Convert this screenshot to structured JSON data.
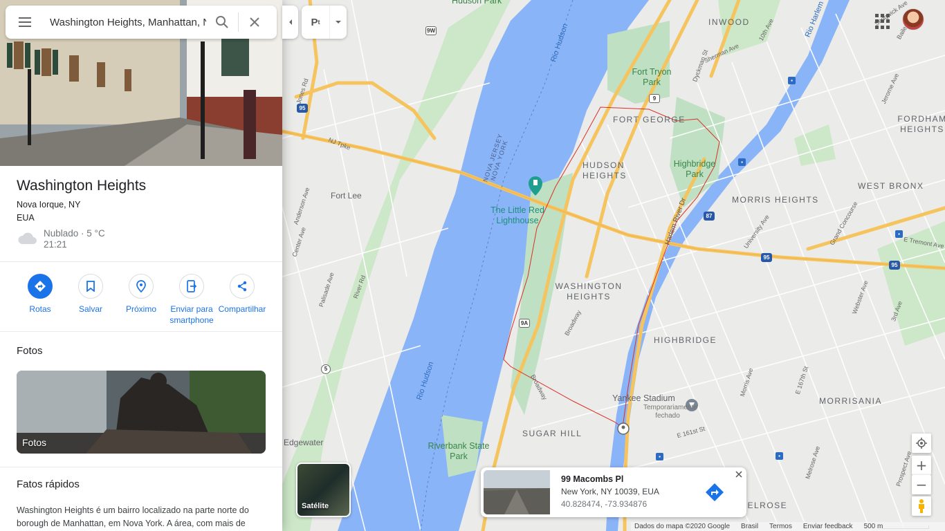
{
  "search": {
    "value": "Washington Heights, Manhattan, N",
    "menu": "menu-icon",
    "search_icon": "search-icon",
    "close_icon": "close-icon"
  },
  "place": {
    "title": "Washington Heights",
    "region": "Nova Iorque, NY",
    "country": "EUA",
    "weather": "Nublado · 5 °C",
    "time": "21:21"
  },
  "actions": [
    {
      "label": "Rotas",
      "icon": "directions-icon"
    },
    {
      "label": "Salvar",
      "icon": "bookmark-icon"
    },
    {
      "label": "Próximo",
      "icon": "nearby-icon"
    },
    {
      "label": "Enviar para smartphone",
      "icon": "send-to-phone-icon"
    },
    {
      "label": "Compartilhar",
      "icon": "share-icon"
    }
  ],
  "photos": {
    "section_title": "Fotos",
    "label": "Fotos"
  },
  "facts": {
    "section_title": "Fatos rápidos",
    "text": "Washington Heights é um bairro localizado na parte norte do borough de Manhattan, em Nova York. A área, com mais de"
  },
  "map": {
    "neighborhoods": [
      "INWOOD",
      "FORT GEORGE",
      "HUDSON HEIGHTS",
      "WASHINGTON HEIGHTS",
      "FORDHAM HEIGHTS",
      "WEST BRONX",
      "MORRIS HEIGHTS",
      "HIGHBRIDGE",
      "MORRISANIA",
      "SUGAR HILL",
      "MELROSE"
    ],
    "parks": [
      "Hudson Park",
      "Fort Tryon Park",
      "Highbridge Park",
      "Riverbank State Park"
    ],
    "water": [
      "Rio Hudson",
      "Rio Hudson",
      "Rio Harlem"
    ],
    "places": [
      "Fort Lee",
      "Edgewater"
    ],
    "poi": "The Little Red Lighthouse",
    "stadium": {
      "name": "Yankee Stadium",
      "status": "Temporariamente fechado"
    },
    "state_line": [
      "NOVA JERSEY",
      "NOVA YORK"
    ],
    "streets": [
      "NJ Tpke",
      "Harlem River Dr",
      "Broadway",
      "Broadway",
      "Dyckman St",
      "Sherman Ave",
      "10th Ave",
      "Jerome Ave",
      "University Ave",
      "Grand Concourse",
      "E Tremont Ave",
      "Webster Ave",
      "3rd Ave",
      "Palisade Ave",
      "Anderson Ave",
      "Center Ave",
      "River Rd",
      "E 161st St",
      "E 167th St",
      "Morris Ave",
      "Prospect Ave",
      "Melrose Ave",
      "Sedgwick Ave",
      "Jones Rd",
      "Bailey Ave"
    ],
    "shields": [
      "9W",
      "95",
      "9",
      "87",
      "95",
      "95",
      "9A",
      "5",
      "9"
    ]
  },
  "layers": {
    "icon": "layers-transit-icon",
    "label": "P"
  },
  "satellite": {
    "label": "Satélite"
  },
  "info_card": {
    "title": "99 Macombs Pl",
    "address": "New York, NY 10039, EUA",
    "coords": "40.828474, -73.934876"
  },
  "zoom": {
    "in": "+",
    "out": "−"
  },
  "footer": {
    "data": "Dados do mapa ©2020 Google",
    "country": "Brasil",
    "terms": "Termos",
    "feedback": "Enviar feedback",
    "scale": "500 m"
  },
  "colors": {
    "accent": "#1a73e8",
    "water": "#8ab4f8",
    "park": "#a8dab5",
    "highway": "#f5c45e",
    "boundary": "#d93025"
  }
}
